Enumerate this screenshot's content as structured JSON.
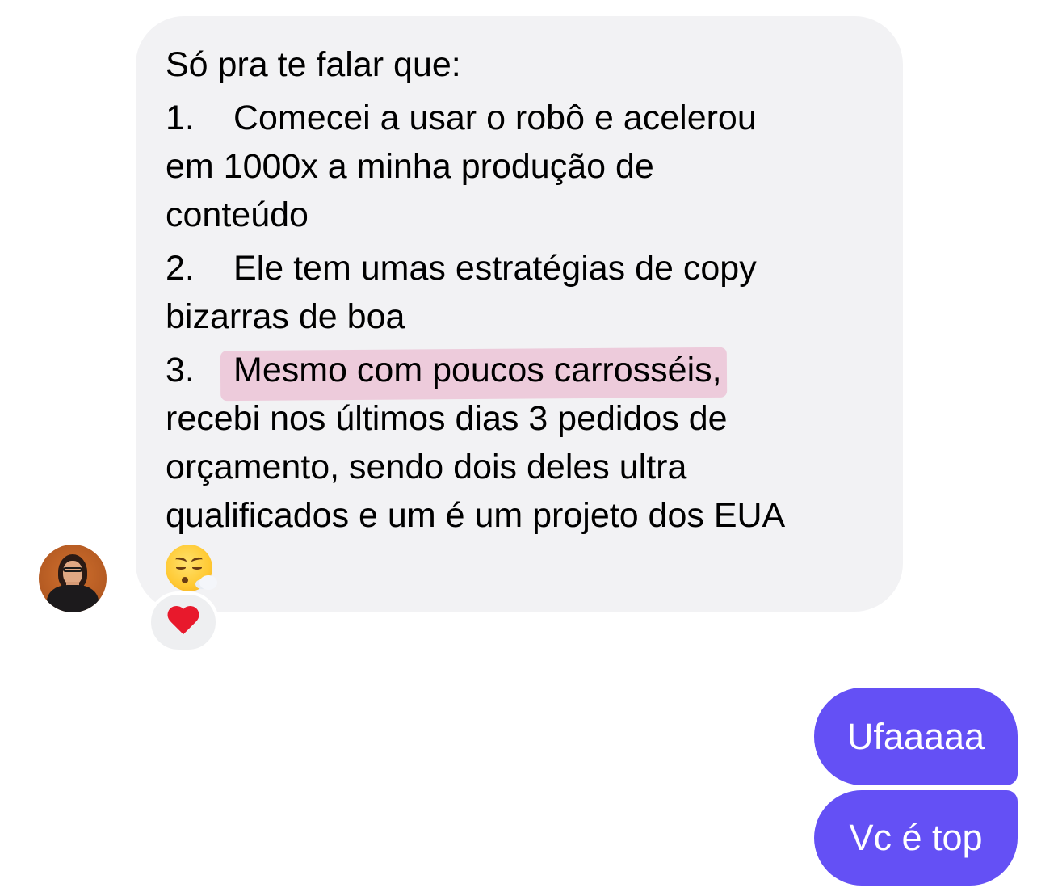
{
  "chat": {
    "incoming_message": {
      "intro": "Só pra te falar que:",
      "items": [
        {
          "number": "1.",
          "first_line": "Comecei a usar o robô e acelerou",
          "rest_lines": [
            "em 1000x a minha produção de",
            "conteúdo"
          ]
        },
        {
          "number": "2.",
          "first_line": "Ele tem umas estratégias de copy",
          "rest_lines": [
            "bizarras de boa"
          ]
        },
        {
          "number": "3.",
          "first_line": "Mesmo com poucos carrosséis,",
          "rest_lines": [
            "recebi nos últimos dias 3 pedidos de",
            "orçamento, sendo dois deles ultra",
            "qualificados e um é um projeto dos EUA"
          ]
        }
      ],
      "trailing_emoji": "face-exhaling-emoji",
      "highlight_color": "#e88cb4",
      "reaction": "heart-icon"
    },
    "outgoing_messages": [
      {
        "text": "Ufaaaaa"
      },
      {
        "text": "Vc é top"
      }
    ],
    "colors": {
      "incoming_bubble": "#f2f2f4",
      "outgoing_bubble": "#6450f5",
      "outgoing_text": "#ffffff"
    }
  }
}
